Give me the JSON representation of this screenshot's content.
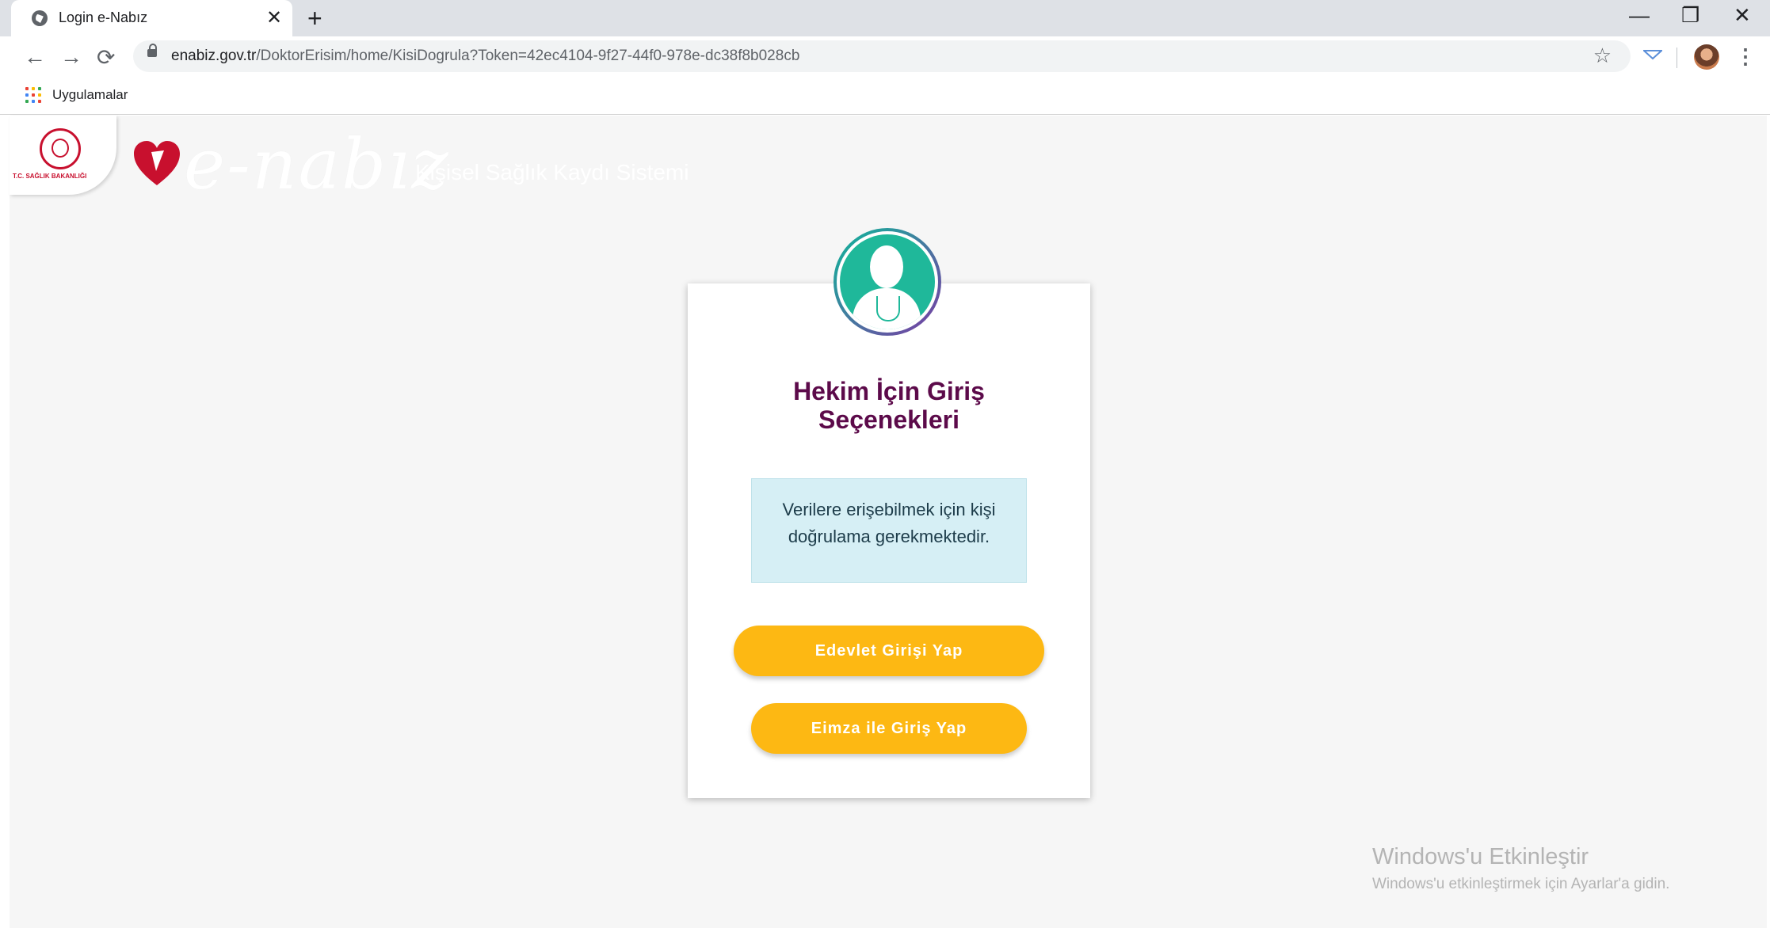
{
  "browser": {
    "tab_title": "Login e-Nabız",
    "tab_close": "✕",
    "new_tab": "+",
    "window_controls": {
      "minimize": "—",
      "restore": "❐",
      "close": "✕"
    },
    "nav": {
      "back": "←",
      "forward": "→",
      "reload": "⟳"
    },
    "url_host": "enabiz.gov.tr",
    "url_path": "/DoktorErisim/home/KisiDogrula?Token=42ec4104-9f27-44f0-978e-dc38f8b028cb",
    "star": "☆",
    "menu": "⋮",
    "bookmarks_label": "Uygulamalar"
  },
  "header": {
    "ministry_text": "T.C. SAĞLIK BAKANLIĞI",
    "brand": "e-nabız",
    "brand_sub": "Kişisel Sağlık Kaydı Sistemi"
  },
  "card": {
    "title_line1": "Hekim İçin Giriş",
    "title_line2": "Seçenekleri",
    "info_line1": "Verilere erişebilmek için kişi",
    "info_line2": "doğrulama gerekmektedir.",
    "edevlet_label": "Edevlet Girişi Yap",
    "eimza_label": "Eimza ile Giriş Yap"
  },
  "watermark": {
    "title": "Windows'u Etkinleştir",
    "subtitle": "Windows'u etkinleştirmek için Ayarlar'a gidin."
  },
  "colors": {
    "title": "#5c0a4a",
    "button": "#fdb813",
    "info_bg": "#d6eff5",
    "avatar": "#1fb89a"
  },
  "icons": [
    "globe-icon",
    "lock-icon",
    "star-icon",
    "apps-icon",
    "doctor-avatar-icon",
    "heart-logo-icon",
    "ministry-seal-icon"
  ]
}
